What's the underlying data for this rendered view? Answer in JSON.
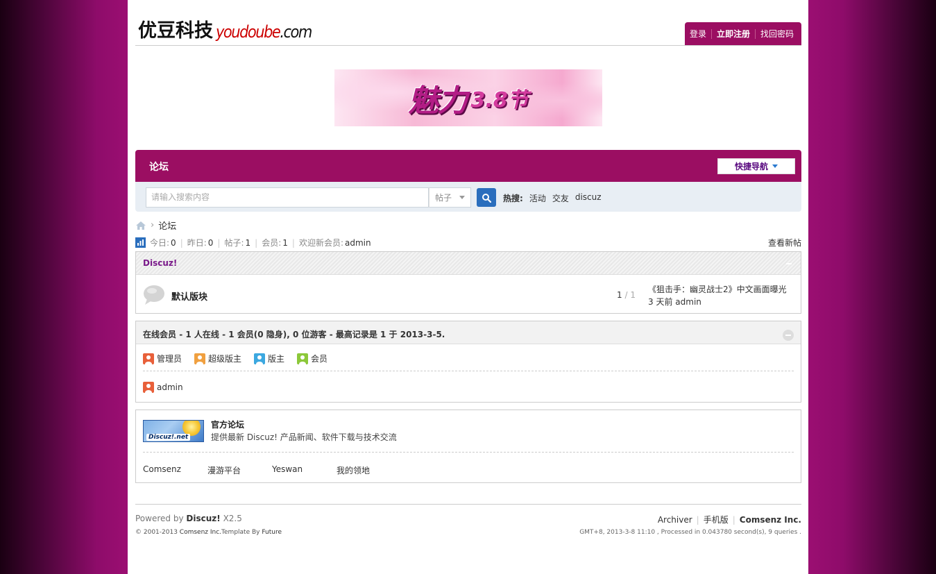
{
  "logo": {
    "cn": "优豆科技",
    "en_red": "youdoube",
    "en_black": ".com"
  },
  "userbar": {
    "login": "登录",
    "register": "立即注册",
    "forgot": "找回密码"
  },
  "banner": {
    "cn": "魅力",
    "num": "3.8节"
  },
  "nav": {
    "title": "论坛",
    "quicknav": "快捷导航"
  },
  "search": {
    "placeholder": "请输入搜索内容",
    "type": "帖子",
    "hot_label": "热搜:",
    "hot_words": [
      "活动",
      "交友",
      "discuz"
    ]
  },
  "breadcrumb": {
    "current": "论坛"
  },
  "stats": {
    "today_label": "今日:",
    "today": "0",
    "yesterday_label": "昨日:",
    "yesterday": "0",
    "posts_label": "帖子:",
    "posts": "1",
    "members_label": "会员:",
    "members": "1",
    "newest_label": "欢迎新会员:",
    "newest": "admin",
    "view_new": "查看新帖"
  },
  "forum_group": {
    "title": "Discuz!",
    "forums": [
      {
        "name": "默认版块",
        "threads": "1",
        "posts": "1",
        "last_title": "《狙击手：幽灵战士2》中文画面曝光",
        "last_time": "3 天前",
        "last_user": "admin"
      }
    ]
  },
  "online": {
    "title_prefix": "在线会员",
    "summary": "- 1 人在线 - 1 会员(0 隐身), 0 位游客 - 最高记录是 1 于 2013-3-5.",
    "legend": [
      {
        "label": "管理员",
        "color": "#e8603a"
      },
      {
        "label": "超级版主",
        "color": "#f0a040"
      },
      {
        "label": "版主",
        "color": "#3ca8e0"
      },
      {
        "label": "会员",
        "color": "#8cc83a"
      }
    ],
    "users": [
      {
        "name": "admin",
        "color": "#e8603a"
      }
    ]
  },
  "links": {
    "logo_text": "Discuz!.net",
    "title": "官方论坛",
    "desc": "提供最新 Discuz! 产品新闻、软件下载与技术交流",
    "items": [
      "Comsenz",
      "漫游平台",
      "Yeswan",
      "我的领地"
    ]
  },
  "footer": {
    "powered_prefix": "Powered by",
    "product": "Discuz!",
    "version": "X2.5",
    "copyright_prefix": "© 2001-2013",
    "company": "Comsenz Inc.",
    "template_prefix": "Template By",
    "template_author": "Future",
    "archiver": "Archiver",
    "mobile": "手机版",
    "company_link": "Comsenz Inc.",
    "time_info": "GMT+8, 2013-3-8 11:10 , Processed in 0.043780 second(s), 9 queries ."
  },
  "colors": {
    "accent": "#9b0e62",
    "search_btn": "#2a6ebd",
    "group_title": "#7a1a8a"
  }
}
